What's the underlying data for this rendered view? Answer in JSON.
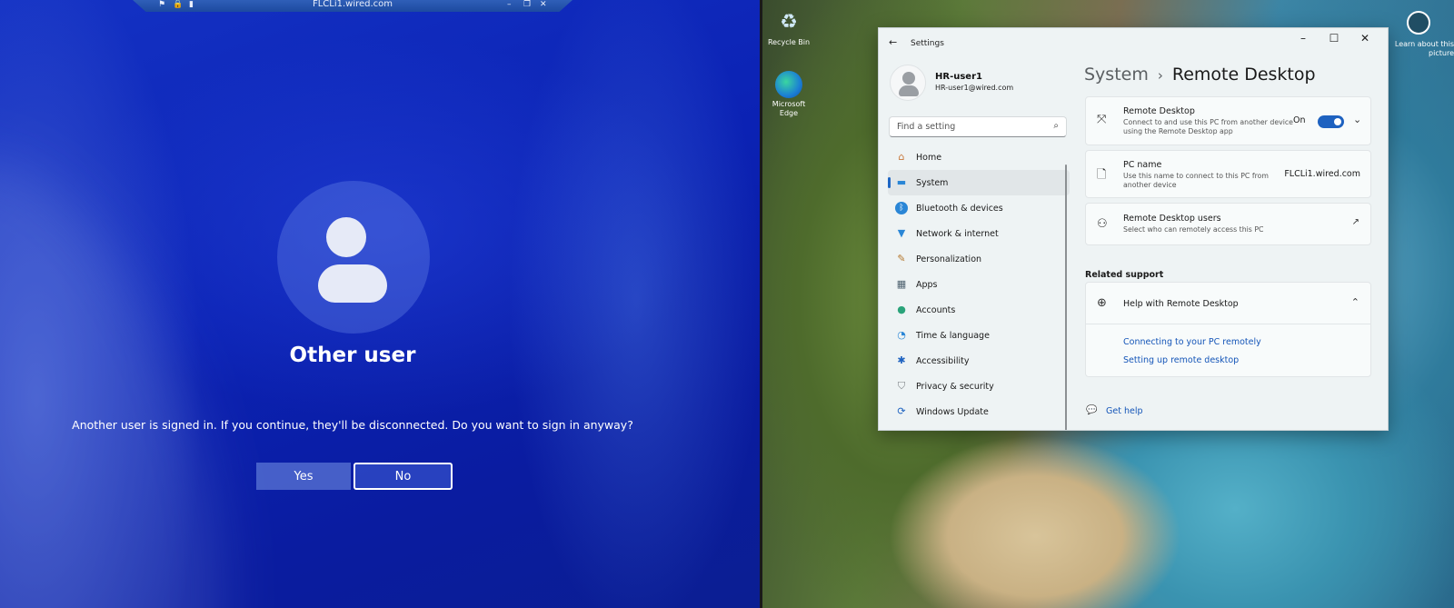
{
  "remote_session": {
    "connection_bar_title": "FLCLi1.wired.com",
    "heading": "Other user",
    "message": "Another user is signed in. If you continue, they'll be disconnected. Do you want to sign in anyway?",
    "yes_label": "Yes",
    "no_label": "No"
  },
  "desktop": {
    "icons": [
      {
        "label": "Recycle Bin",
        "icon": "recycle-bin-icon"
      },
      {
        "label": "Microsoft Edge",
        "icon": "edge-icon"
      }
    ],
    "corner_text": "Learn about this picture"
  },
  "settings": {
    "title": "Settings",
    "user": {
      "name": "HR-user1",
      "email": "HR-user1@wired.com"
    },
    "search_placeholder": "Find a setting",
    "nav": [
      {
        "label": "Home",
        "icon": "home-icon",
        "active": false
      },
      {
        "label": "System",
        "icon": "system-icon",
        "active": true
      },
      {
        "label": "Bluetooth & devices",
        "icon": "bluetooth-icon",
        "active": false
      },
      {
        "label": "Network & internet",
        "icon": "wifi-icon",
        "active": false
      },
      {
        "label": "Personalization",
        "icon": "brush-icon",
        "active": false
      },
      {
        "label": "Apps",
        "icon": "apps-icon",
        "active": false
      },
      {
        "label": "Accounts",
        "icon": "accounts-icon",
        "active": false
      },
      {
        "label": "Time & language",
        "icon": "globe-clock-icon",
        "active": false
      },
      {
        "label": "Accessibility",
        "icon": "accessibility-icon",
        "active": false
      },
      {
        "label": "Privacy & security",
        "icon": "shield-icon",
        "active": false
      },
      {
        "label": "Windows Update",
        "icon": "update-icon",
        "active": false
      }
    ],
    "breadcrumb": {
      "parent": "System",
      "current": "Remote Desktop"
    },
    "remote_desktop": {
      "title": "Remote Desktop",
      "description": "Connect to and use this PC from another device using the Remote Desktop app",
      "toggle_state": "On",
      "toggle_on": true
    },
    "pc_name": {
      "title": "PC name",
      "description": "Use this name to connect to this PC from another device",
      "value": "FLCLi1.wired.com"
    },
    "rd_users": {
      "title": "Remote Desktop users",
      "description": "Select who can remotely access this PC"
    },
    "related_support": "Related support",
    "help": {
      "title": "Help with Remote Desktop",
      "links": [
        "Connecting to your PC remotely",
        "Setting up remote desktop"
      ]
    },
    "get_help": "Get help",
    "accent_color": "#1e62c0"
  }
}
